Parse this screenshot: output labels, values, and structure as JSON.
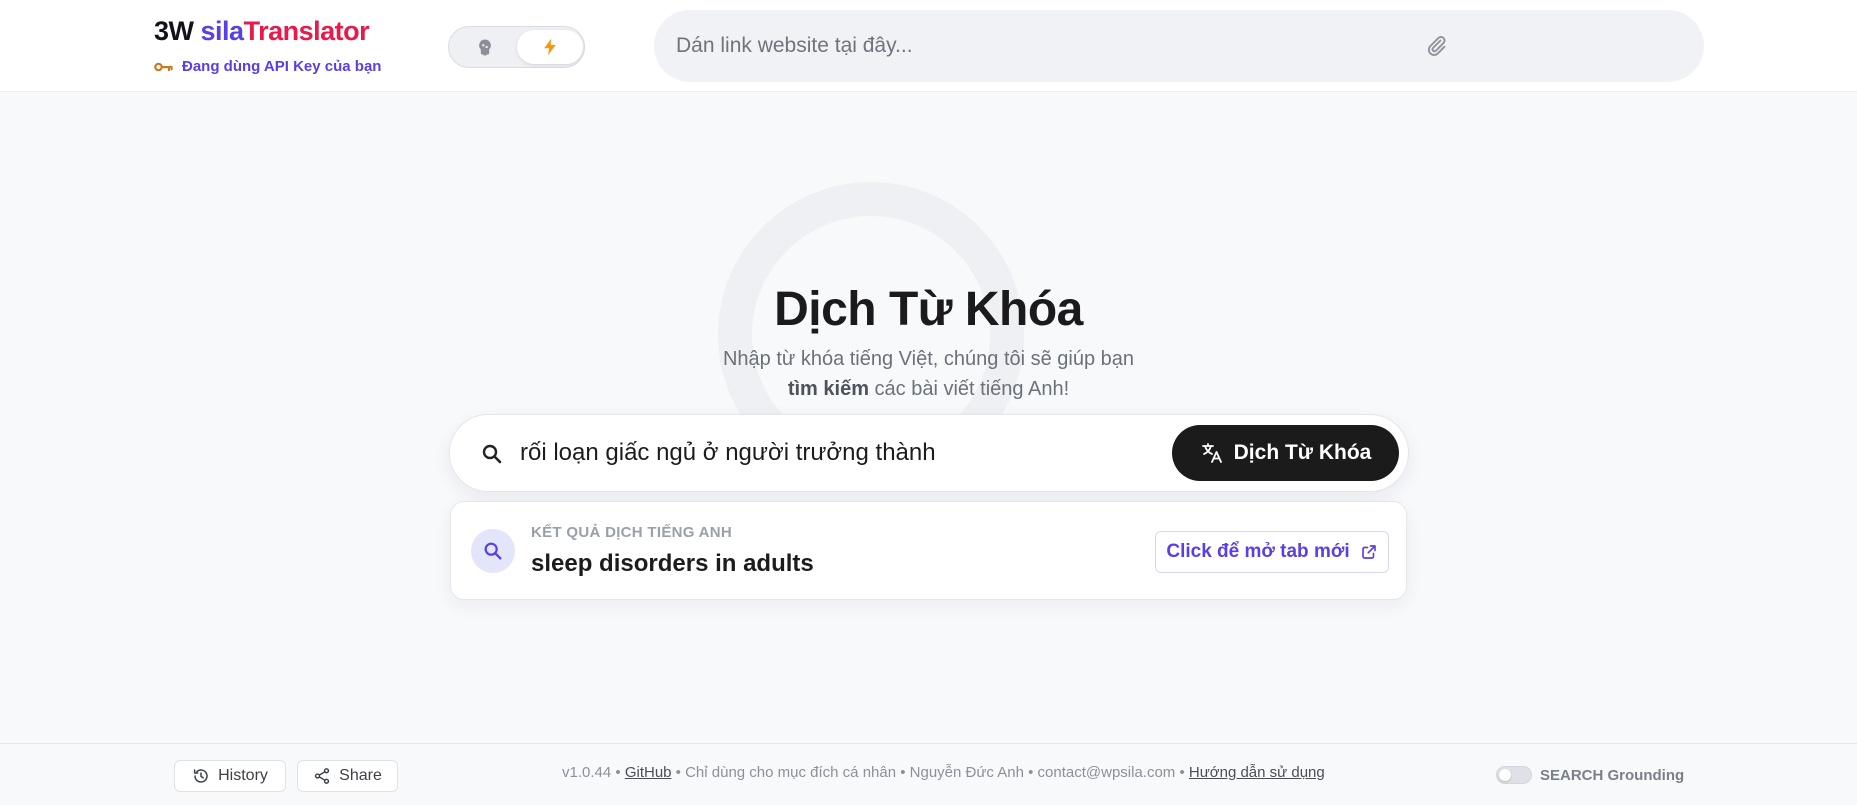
{
  "header": {
    "brand": {
      "part1": "3W ",
      "part2": "sila",
      "part3": "Translator"
    },
    "api_key_status": "Đang dùng API Key của bạn",
    "url_placeholder": "Dán link website tại đây..."
  },
  "hero": {
    "title": "Dịch Từ Khóa",
    "subtitle_line1": "Nhập từ khóa tiếng Việt, chúng tôi sẽ giúp bạn",
    "subtitle_bold": "tìm kiếm",
    "subtitle_rest": " các bài viết tiếng Anh!"
  },
  "search": {
    "value": "rối loạn giấc ngủ ở người trưởng thành",
    "button_label": "Dịch Từ Khóa"
  },
  "result": {
    "label": "KẾT QUẢ DỊCH TIẾNG ANH",
    "text": "sleep disorders in adults",
    "open_label": "Click để mở tab mới"
  },
  "footer": {
    "history_label": "History",
    "share_label": "Share",
    "version": "v1.0.44",
    "sep": " • ",
    "github": "GitHub",
    "personal_use": "Chỉ dùng cho mục đích cá nhân",
    "author": "Nguyễn Đức Anh",
    "email": "contact@wpsila.com",
    "guide": "Hướng dẫn sử dụng",
    "grounding_label": "SEARCH Grounding"
  },
  "colors": {
    "accent": "#5a3ee6",
    "brand_red": "#e8194b",
    "primary_button": "#1b1b1b"
  }
}
